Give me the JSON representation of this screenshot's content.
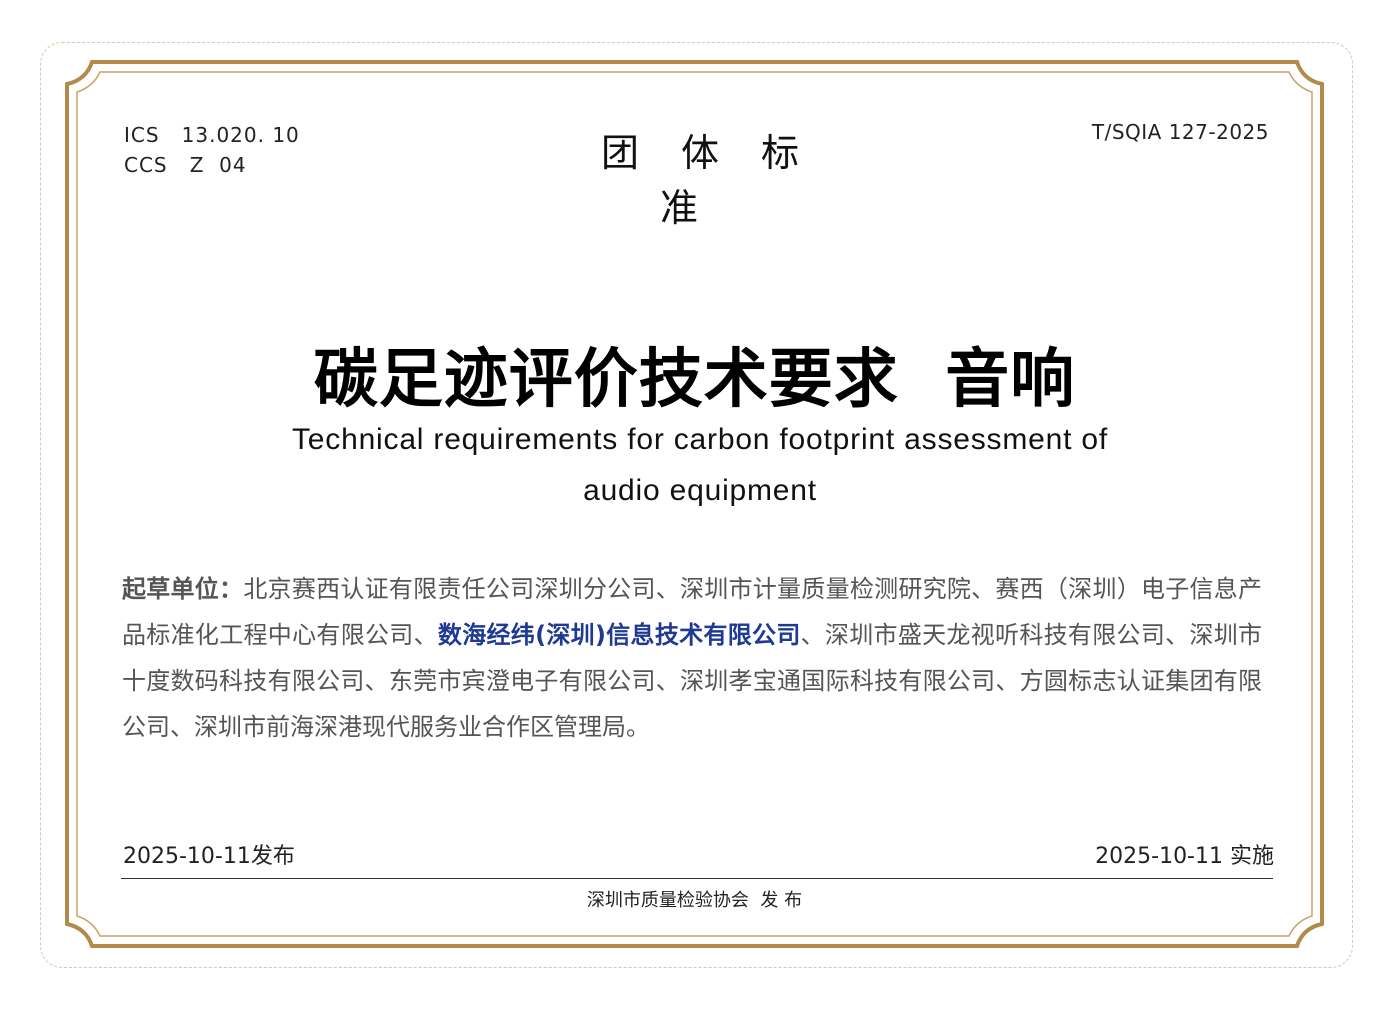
{
  "header": {
    "ics_label": "ICS",
    "ics_code": "13.020. 10",
    "ccs_label": "CCS",
    "ccs_code": "Z  04",
    "standard_type": "团体标准",
    "standard_number": "T/SQIA 127-2025"
  },
  "title": {
    "chinese": "碳足迹评价技术要求  音响",
    "english_line1": "Technical requirements for carbon footprint assessment of",
    "english_line2": "audio equipment"
  },
  "drafters": {
    "label": "起草单位：",
    "text_before": "北京赛西认证有限责任公司深圳分公司、深圳市计量质量检测研究院、赛西（深圳）电子信息产品标准化工程中心有限公司、",
    "highlighted": "数海经纬(深圳)信息技术有限公司",
    "text_after": "、深圳市盛天龙视听科技有限公司、深圳市十度数码科技有限公司、东莞市宾澄电子有限公司、深圳孝宝通国际科技有限公司、方圆标志认证集团有限公司、深圳市前海深港现代服务业合作区管理局。"
  },
  "footer": {
    "publish_date": "2025-10-11发布",
    "implement_date": "2025-10-11 实施",
    "issuer": "深圳市质量检验协会  发 布"
  },
  "colors": {
    "frame_gold": "#b48a4a",
    "highlight_blue": "#1f3a93",
    "body_gray": "#555555"
  }
}
